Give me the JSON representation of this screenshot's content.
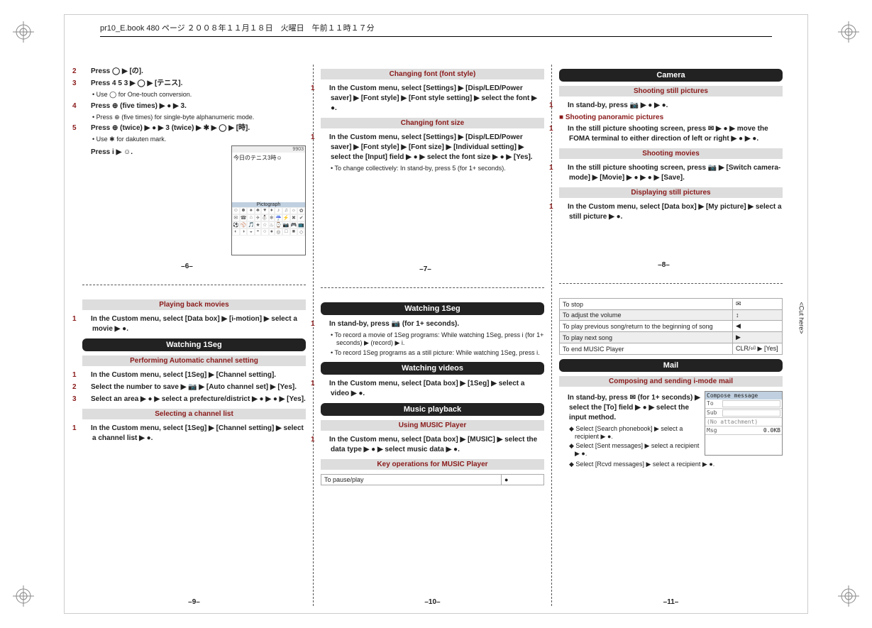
{
  "meta": {
    "header": "pr10_E.book  480 ページ  ２００８年１１月１８日　火曜日　午前１１時１７分",
    "cut_here": "<Cut here>"
  },
  "col1": {
    "step2": "Press ◯ ▶ [の].",
    "step3": "Press 4 5 3 ▶ ◯ ▶ [テニス].",
    "note3": "• Use ◯ for One-touch conversion.",
    "step4": "Press ⊕ (five times) ▶ ● ▶ 3.",
    "note4": "• Press ⊕ (five times) for single-byte alphanumeric mode.",
    "step5": "Press ⊕ (twice) ▶ ● ▶ 3 (twice) ▶ ✱ ▶ ◯ ▶ [時].",
    "note5": "• Use ✱ for dakuten mark.",
    "step6": "Press i ▶ ☺.",
    "phone_status": "9903",
    "phone_text": "今日のテニス3時☺",
    "phone_pict": "Pictograph",
    "pagenum": "–6–"
  },
  "col2": {
    "sec1": "Changing font (font style)",
    "s1step": "In the Custom menu, select [Settings] ▶ [Disp/LED/Power saver] ▶ [Font style] ▶ [Font style setting] ▶ select the font ▶ ●.",
    "sec2": "Changing font size",
    "s2step": "In the Custom menu, select [Settings] ▶ [Disp/LED/Power saver] ▶ [Font style] ▶ [Font size] ▶ [Individual setting] ▶ select the [Input] field ▶ ● ▶ select the font size ▶ ● ▶ [Yes].",
    "s2note": "• To change collectively: In stand-by, press 5 (for 1+ seconds).",
    "pagenum": "–7–"
  },
  "col3": {
    "camera": "Camera",
    "sec1": "Shooting still pictures",
    "s1step": "In stand-by, press 📷 ▶ ● ▶ ●.",
    "subhead": "■ Shooting panoramic pictures",
    "s1bstep": "In the still picture shooting screen, press ✉ ▶ ● ▶ move the FOMA terminal to either direction of left or right ▶ ● ▶ ●.",
    "sec2": "Shooting movies",
    "s2step": "In the still picture shooting screen, press 📷 ▶ [Switch camera-mode] ▶ [Movie] ▶ ● ▶ ● ▶ [Save].",
    "sec3": "Displaying still pictures",
    "s3step": "In the Custom menu, select [Data box] ▶ [My picture] ▶ select a still picture ▶ ●.",
    "pagenum": "–8–"
  },
  "col4": {
    "sec1": "Playing back movies",
    "s1step": "In the Custom menu, select [Data box] ▶ [i-motion] ▶ select a movie ▶ ●.",
    "watch": "Watching 1Seg",
    "sec2": "Performing Automatic channel setting",
    "s2step1": "In the Custom menu, select [1Seg] ▶ [Channel setting].",
    "s2step2": "Select the number to save ▶ 📷 ▶ [Auto channel set] ▶ [Yes].",
    "s2step3": "Select an area ▶ ● ▶ select a prefecture/district ▶ ● ▶ ● ▶ [Yes].",
    "sec3": "Selecting a channel list",
    "s3step": "In the Custom menu, select [1Seg] ▶ [Channel setting] ▶ select a channel list ▶ ●.",
    "pagenum": "–9–"
  },
  "col5": {
    "watch": "Watching 1Seg",
    "s1step": "In stand-by, press 📷 (for 1+ seconds).",
    "s1note1": "• To record a movie of 1Seg programs: While watching 1Seg, press i (for 1+ seconds) ▶ (record) ▶ i.",
    "s1note2": "• To record 1Seg programs as a still picture: While watching 1Seg, press i.",
    "videos": "Watching videos",
    "s2step": "In the Custom menu, select [Data box] ▶ [1Seg] ▶ select a video ▶ ●.",
    "music": "Music playback",
    "sec3": "Using MUSIC Player",
    "s3step": "In the Custom menu, select [Data box] ▶ [MUSIC] ▶ select the data type ▶ ● ▶ select music data ▶ ●.",
    "sec4": "Key operations for MUSIC Player",
    "tbl_pause": "To pause/play",
    "tbl_pause_k": "●",
    "pagenum": "–10–"
  },
  "col6": {
    "tbl": {
      "r1a": "To stop",
      "r1b": "✉",
      "r2a": "To adjust the volume",
      "r2b": "↕",
      "r3a": "To play previous song/return to the beginning of song",
      "r3b": "◀",
      "r4a": "To play next song",
      "r4b": "▶",
      "r5a": "To end MUSIC Player",
      "r5b": "CLR/⏎ ▶ [Yes]"
    },
    "mail": "Mail",
    "sec1": "Composing and sending i-mode mail",
    "s1step": "In stand-by, press ✉ (for 1+ seconds) ▶ select the [To] field ▶ ● ▶ select the input method.",
    "b1": "◆ Select [Search phonebook] ▶ select a recipient ▶ ●.",
    "b2": "◆ Select [Sent messages] ▶ select a recipient ▶ ●.",
    "b3": "◆ Select [Rcvd messages] ▶ select a recipient ▶ ●.",
    "compose": {
      "title": "Compose message",
      "to": "To",
      "sub": "Sub",
      "att": "(No attachment)",
      "msg": "Msg",
      "size": "0.0KB"
    },
    "pagenum": "–11–"
  }
}
